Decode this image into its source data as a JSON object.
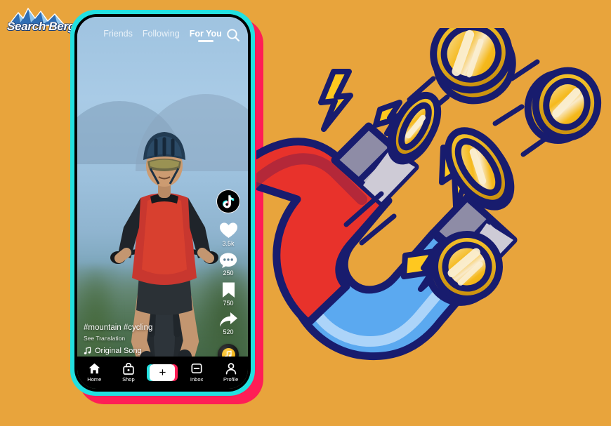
{
  "brand": {
    "name": "Search Berg",
    "logo_icon": "mountain-peaks-icon",
    "mountain_color": "#2E6DB4",
    "text_color": "#FFFFFF"
  },
  "canvas": {
    "background_color": "#E8A43C"
  },
  "phone": {
    "frame_color": "#000000",
    "accent_cyan": "#23E0E0",
    "accent_pink": "#FF1E56",
    "top_nav": {
      "tabs": [
        {
          "label": "Friends",
          "active": false
        },
        {
          "label": "Following",
          "active": false
        },
        {
          "label": "For You",
          "active": true
        }
      ],
      "search_icon": "search-icon"
    },
    "video": {
      "subject": "mountain-biker-photo",
      "avatar_icon": "tiktok-note-icon",
      "actions": [
        {
          "icon": "heart-icon",
          "count": "3.5k"
        },
        {
          "icon": "comment-icon",
          "count": "250"
        },
        {
          "icon": "bookmark-icon",
          "count": "750"
        },
        {
          "icon": "share-icon",
          "count": "520"
        }
      ],
      "music_disc_icon": "music-note-disc-icon",
      "caption": {
        "hashtags": "#mountain #cycling",
        "translate": "See Translation",
        "song_icon": "music-note-icon",
        "song": "Original Song"
      }
    },
    "tab_bar": [
      {
        "label": "Home",
        "icon": "home-icon"
      },
      {
        "label": "Shop",
        "icon": "shopping-bag-icon"
      },
      {
        "label": "",
        "icon": "plus-icon"
      },
      {
        "label": "Inbox",
        "icon": "inbox-icon"
      },
      {
        "label": "Profile",
        "icon": "person-icon"
      }
    ],
    "create_label": "+"
  },
  "artwork": {
    "magnet_icon": "horseshoe-magnet-icon",
    "magnet_red": "#E8322B",
    "magnet_blue": "#5BA9F0",
    "magnet_outline": "#181C6E",
    "magnet_tip": "#B7B4C4",
    "coin_icon": "gold-coin-icon",
    "coin_gold": "#F5B91C",
    "coin_light": "#F7E6B8",
    "coin_count": 5,
    "bolt_icon": "lightning-bolt-icon",
    "bolt_color": "#FFC81F",
    "bolt_count": 4,
    "motion_line_color": "#181C6E"
  }
}
